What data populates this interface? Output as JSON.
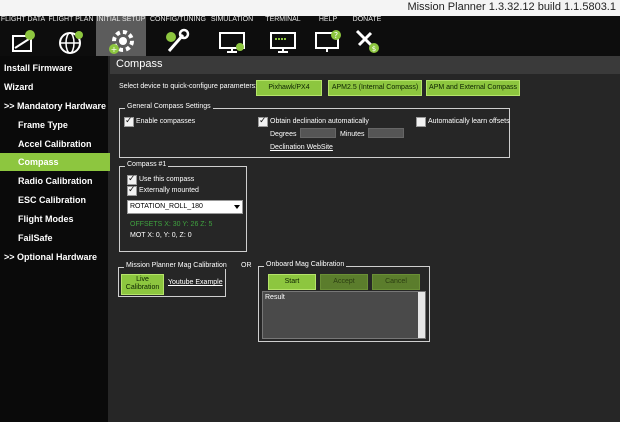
{
  "window": {
    "title": "Mission Planner 1.3.32.12 build 1.1.5803.1"
  },
  "tabs": [
    {
      "label": "FLIGHT DATA",
      "icon": "flight-data-icon"
    },
    {
      "label": "FLIGHT PLAN",
      "icon": "globe-icon"
    },
    {
      "label": "INITIAL SETUP",
      "icon": "gear-icon"
    },
    {
      "label": "CONFIG/TUNING",
      "icon": "wrench-icon"
    },
    {
      "label": "SIMULATION",
      "icon": "monitor-icon"
    },
    {
      "label": "TERMINAL",
      "icon": "terminal-icon"
    },
    {
      "label": "HELP",
      "icon": "help-monitor-icon"
    },
    {
      "label": "DONATE",
      "icon": "plane-dollar-icon"
    }
  ],
  "sidebar": {
    "items": [
      {
        "label": "Install Firmware"
      },
      {
        "label": "Wizard"
      },
      {
        "label": ">> Mandatory Hardware"
      },
      {
        "label": "Frame Type"
      },
      {
        "label": "Accel Calibration"
      },
      {
        "label": "Compass"
      },
      {
        "label": "Radio Calibration"
      },
      {
        "label": "ESC Calibration"
      },
      {
        "label": "Flight Modes"
      },
      {
        "label": "FailSafe"
      },
      {
        "label": ">> Optional Hardware"
      }
    ]
  },
  "compass": {
    "title": "Compass",
    "quick_label": "Select device to quick-configure parameters:",
    "quick_buttons": [
      "Pixhawk/PX4",
      "APM2.5 (Internal Compass)",
      "APM and External Compass"
    ],
    "general": {
      "title": "General Compass Settings",
      "enable": "Enable compasses",
      "obtain_decl": "Obtain declination automatically",
      "learn_offsets": "Automatically learn offsets",
      "degrees": "Degrees",
      "minutes": "Minutes",
      "decl_link": "Declination WebSite"
    },
    "compass1": {
      "title": "Compass #1",
      "use": "Use this compass",
      "external": "Externally mounted",
      "rotation": "ROTATION_ROLL_180",
      "offsets": "OFFSETS X: 30   Y: 26   Z: 5",
      "mot": "MOT       X: 0,   Y: 0,   Z: 0"
    },
    "mp_mag": {
      "title": "Mission Planner Mag Calibration",
      "live": "Live Calibration",
      "youtube": "Youtube Example"
    },
    "or_label": "OR",
    "onboard": {
      "title": "Onboard Mag Calibration",
      "start": "Start",
      "accept": "Accept",
      "cancel": "Cancel",
      "result": "Result"
    }
  }
}
